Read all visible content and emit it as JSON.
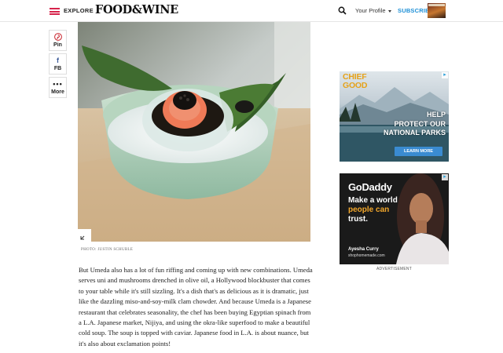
{
  "header": {
    "menu_icon": "hamburger-icon",
    "explore_label": "EXPLORE",
    "logo": "FOOD&WINE",
    "search_icon": "search-icon",
    "profile_label": "Your Profile",
    "subscribe_label": "SUBSCRIBE",
    "accent_color": "#d6234b",
    "subscribe_color": "#1c8fd6"
  },
  "share": {
    "pin_label": "Pin",
    "fb_label": "FB",
    "more_label": "More"
  },
  "hero": {
    "photo_credit": "PHOTO: JUSTIN SCHUBLE",
    "expand_icon": "expand-icon"
  },
  "article": {
    "paragraph": "But Umeda also has a lot of fun riffing and coming up with new combinations. Umeda serves uni and mushrooms drenched in olive oil, a Hollywood blockbuster that comes to your table while it's still sizzling. It's a dish that's as delicious as it is dramatic, just like the dazzling miso-and-soy-milk clam chowder. And because Umeda is a Japanese restaurant that celebrates seasonality, the chef has been buying Egyptian spinach from a L.A. Japanese market, Nijiya, and using the okra-like superfood to make a beautiful cold soup. The soup is topped with caviar. Japanese food in L.A. is about nuance, but it's also about exclamation points!"
  },
  "ads": {
    "parks": {
      "brand_top": "CHIEF",
      "brand_bottom": "GOOD",
      "copy_lines": [
        "HELP",
        "PROTECT OUR",
        "NATIONAL PARKS"
      ],
      "cta": "LEARN MORE"
    },
    "godaddy": {
      "logo": "GoDaddy",
      "headline_line1": "Make a world",
      "headline_line2": "people can",
      "headline_line3": "trust.",
      "name": "Ayesha Curry",
      "site": "shophomemade.com"
    },
    "label": "ADVERTISEMENT"
  }
}
